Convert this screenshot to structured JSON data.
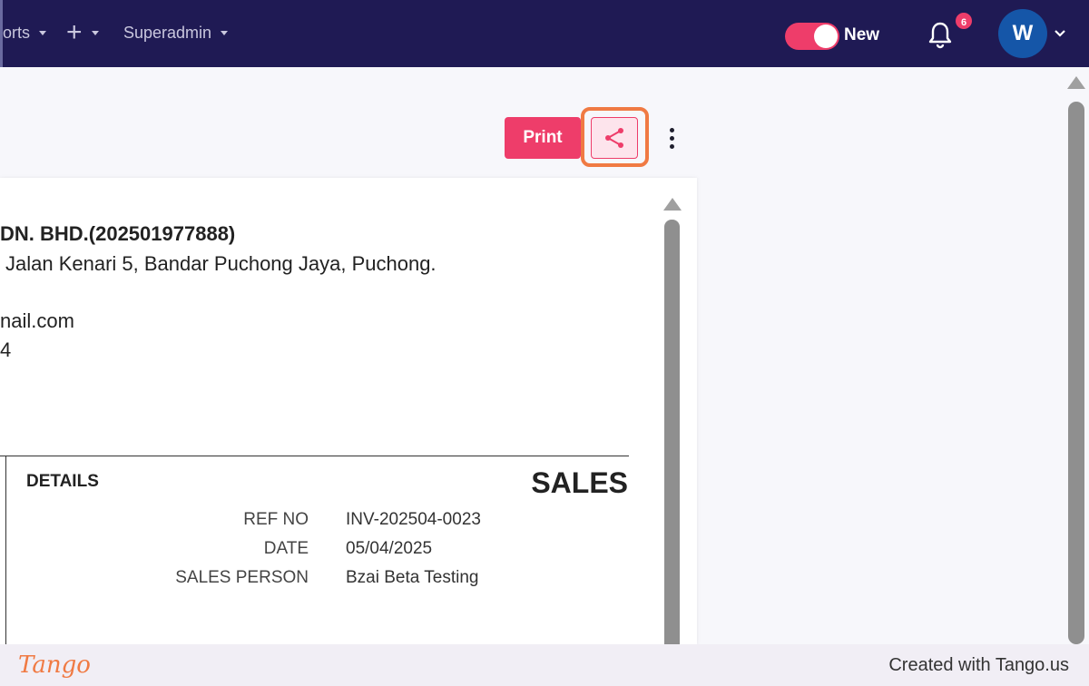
{
  "topbar": {
    "nav": [
      {
        "label": "orts"
      },
      {
        "label": "+"
      },
      {
        "label": "Superadmin"
      }
    ],
    "toggle_label": "New",
    "notifications_count": "6",
    "avatar_initial": "W"
  },
  "toolbar": {
    "print_label": "Print",
    "share_icon": "share-icon",
    "more_icon": "kebab-menu-icon"
  },
  "document": {
    "company_name": "DN. BHD.(202501977888)",
    "address": "Jalan Kenari 5, Bandar Puchong Jaya, Puchong.",
    "email": "nail.com",
    "phone": "4",
    "details_label": "DETAILS",
    "doc_type": "SALES",
    "fields": [
      {
        "label": "REF NO",
        "value": "INV-202504-0023"
      },
      {
        "label": "DATE",
        "value": "05/04/2025"
      },
      {
        "label": "SALES PERSON",
        "value": "Bzai Beta Testing"
      }
    ]
  },
  "footer": {
    "logo": "Tango",
    "created": "Created with Tango.us"
  },
  "colors": {
    "navbar": "#1f1a54",
    "accent": "#ee3d6a",
    "highlight": "#f07a43",
    "avatar": "#1556a8"
  }
}
